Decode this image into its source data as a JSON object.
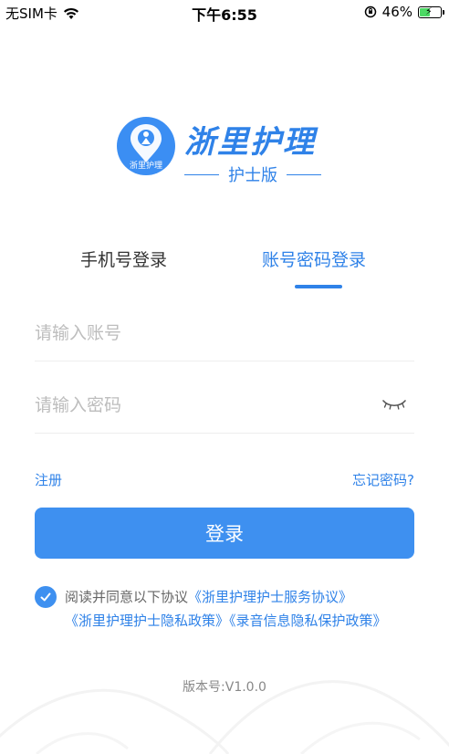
{
  "status_bar": {
    "carrier": "无SIM卡",
    "time": "下午6:55",
    "battery_percent": "46%",
    "battery_level": 0.46,
    "charging": true
  },
  "brand": {
    "title": "浙里护理",
    "subtitle": "护士版",
    "badge_text": "浙里护理",
    "color": "#2f82e8"
  },
  "tabs": {
    "phone_login": "手机号登录",
    "account_login": "账号密码登录",
    "active": "account_login"
  },
  "form": {
    "account_placeholder": "请输入账号",
    "account_value": "",
    "password_placeholder": "请输入密码",
    "password_value": "",
    "password_visibility_icon": "eye-closed-icon"
  },
  "links": {
    "register": "注册",
    "forgot_password": "忘记密码?"
  },
  "login_button": "登录",
  "agreement": {
    "checked": true,
    "prefix": "阅读并同意以下协议",
    "policy_service": "《浙里护理护士服务协议》",
    "policy_privacy": "《浙里护理护士隐私政策》",
    "policy_recording": "《录音信息隐私保护政策》"
  },
  "version": "版本号:V1.0.0",
  "colors": {
    "accent": "#3e90f0",
    "placeholder": "#bdbdbd"
  }
}
